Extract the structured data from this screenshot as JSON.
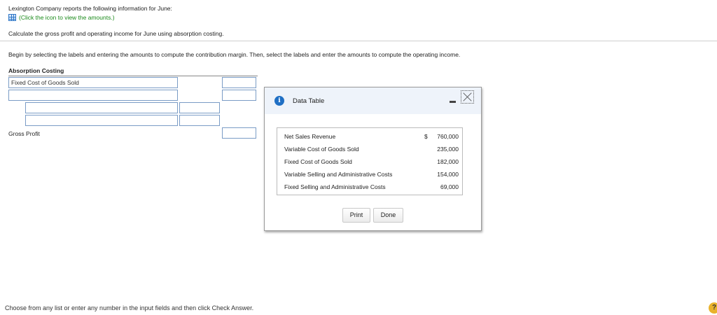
{
  "intro": {
    "text": "Lexington Company reports the following information for June:",
    "link": "(Click the icon to view the amounts.)"
  },
  "question": "Calculate the gross profit and operating income for June using absorption costing.",
  "instructions": "Begin by selecting the labels and entering the amounts to compute the contribution margin. Then, select the labels and enter the amounts to compute the operating income.",
  "worksheet": {
    "title": "Absorption Costing",
    "row1_label_value": "Fixed Cost of Goods Sold",
    "gross_profit_label": "Gross Profit"
  },
  "dialog": {
    "title": "Data Table",
    "currency": "$",
    "rows": [
      {
        "label": "Net Sales Revenue",
        "value": "760,000"
      },
      {
        "label": "Variable Cost of Goods Sold",
        "value": "235,000"
      },
      {
        "label": "Fixed Cost of Goods Sold",
        "value": "182,000"
      },
      {
        "label": "Variable Selling and Administrative Costs",
        "value": "154,000"
      },
      {
        "label": "Fixed Selling and Administrative Costs",
        "value": "69,000"
      }
    ],
    "print_label": "Print",
    "done_label": "Done"
  },
  "footer": "Choose from any list or enter any number in the input fields and then click Check Answer.",
  "help_symbol": "?",
  "colors": {
    "accent": "#1f6fc4",
    "link": "#1a8a1a",
    "help": "#e9b22c"
  }
}
